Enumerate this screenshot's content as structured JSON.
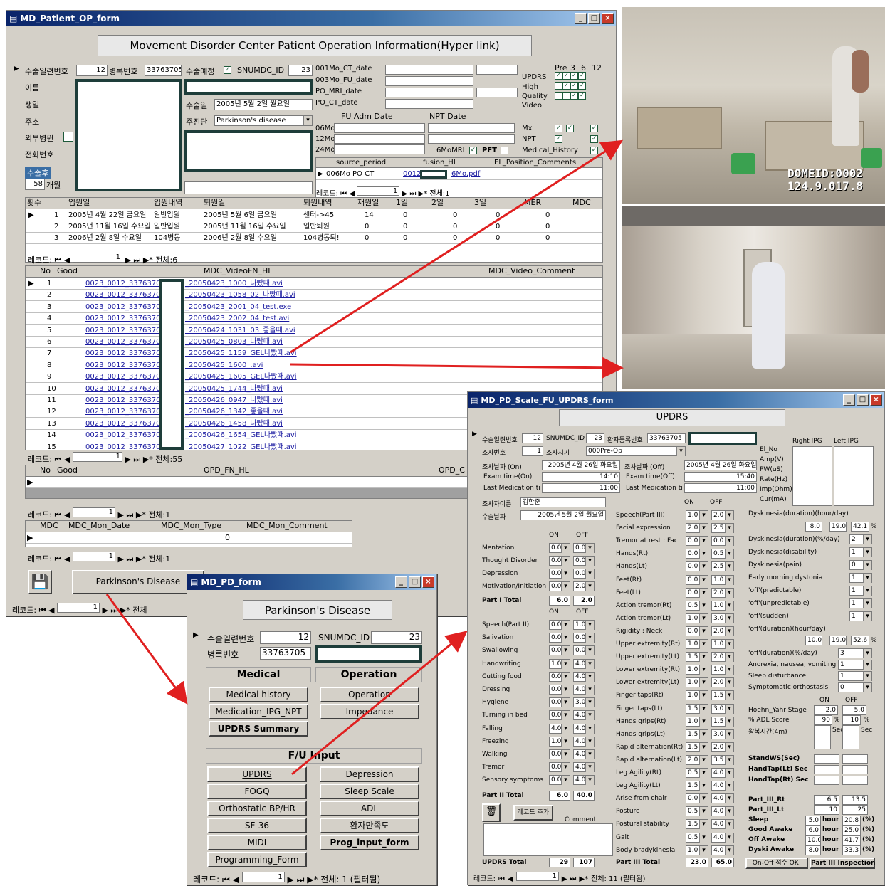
{
  "op_form": {
    "title": "MD_Patient_OP_form",
    "banner": "Movement Disorder Center Patient Operation Information(Hyper link)",
    "labels": {
      "serial": "수술일련번호",
      "name": "이름",
      "birth": "생일",
      "address": "주소",
      "ext_hosp": "외부병원",
      "phone": "전화번호",
      "after_op": "수술후",
      "months": "개월",
      "reg_no": "병록번호",
      "planned": "수술예정",
      "snumdc": "SNUMDC_ID",
      "op_date": "수술일",
      "diag": "주진단"
    },
    "values": {
      "serial": "12",
      "reg_no": "33763705",
      "snumdc": "23",
      "op_date": "2005년 5월 2일 월요일",
      "diag": "Parkinson's disease",
      "months": "58"
    },
    "dates": [
      "001Mo_CT_date",
      "003Mo_FU_date",
      "PO_MRI_date",
      "PO_CT_date"
    ],
    "fu_adm": "FU Adm Date",
    "npt_date": "NPT Date",
    "fu_rows": [
      "06Mo",
      "12Mo",
      "24Mo"
    ],
    "pre_cols": [
      "Pre",
      "3",
      "6",
      "12"
    ],
    "video_labels": [
      "UPDRS",
      "High",
      "Quality",
      "Video"
    ],
    "mx": "Mx",
    "npt": "NPT",
    "mri6": "6MoMRI",
    "pft": "PFT",
    "med_hist": "Medical_History",
    "sub_headers": [
      "source_period",
      "fusion_HL",
      "EL_Position_Comments"
    ],
    "sub_row": {
      "period": "006Mo PO CT",
      "fusion": "0012",
      "file": "6Mo.pdf"
    },
    "sub_nav": {
      "label": "레코드:",
      "pos": "1",
      "total": "전체:1"
    },
    "adm_headers": [
      "횟수",
      "입원일",
      "입원내역",
      "퇴원일",
      "퇴원내역",
      "재원일",
      "1일",
      "2일",
      "3일",
      "MER",
      "MDC"
    ],
    "adm_rows": [
      [
        "1",
        "2005년 4월 22일 금요일",
        "일반입원",
        "2005년 5월 6일 금요일",
        "센터->45",
        "14",
        "0",
        "0",
        "0",
        "0"
      ],
      [
        "2",
        "2005년 11월 16일 수요일",
        "일반입원",
        "2005년 11월 16일 수요일",
        "일반퇴원",
        "0",
        "0",
        "0",
        "0",
        "0"
      ],
      [
        "3",
        "2006년 2월 8일 수요일",
        "104병동!",
        "2006년 2월 8일 수요일",
        "104병동퇴!",
        "0",
        "0",
        "0",
        "0",
        "0"
      ]
    ],
    "adm_nav": {
      "label": "레코드:",
      "pos": "1",
      "total": "전체:6"
    },
    "video_headers": [
      "No",
      "Good",
      "MDC_VideoFN_HL",
      "MDC_Video_Comment"
    ],
    "video_prefix": "0023_0012_33763705",
    "video_rows": [
      [
        "1",
        "_20050423_1000_나빴때.avi"
      ],
      [
        "2",
        "_20050423_1058_02_나빴때.avi"
      ],
      [
        "3",
        "_20050423_2001_04_test.exe"
      ],
      [
        "4",
        "_20050423_2002_04_test.avi"
      ],
      [
        "5",
        "_20050424_1031_03_좋을때.avi"
      ],
      [
        "6",
        "_20050425_0803_나빴때.avi"
      ],
      [
        "7",
        "_20050425_1159_GEL나빴때.avi"
      ],
      [
        "8",
        "_20050425_1600_.avi"
      ],
      [
        "9",
        "_20050425_1605_GEL나빴때.avi"
      ],
      [
        "10",
        "_20050425_1744_나빴때.avi"
      ],
      [
        "11",
        "_20050426_0947_나빴때.avi"
      ],
      [
        "12",
        "_20050426_1342_좋을때.avi"
      ],
      [
        "13",
        "_20050426_1458_나빴때.avi"
      ],
      [
        "14",
        "_20050426_1654_GEL나빴때.avi"
      ],
      [
        "15",
        "_20050427_1022_GEL나빴때.avi"
      ]
    ],
    "video_nav": {
      "label": "레코드:",
      "pos": "1",
      "total": "전체:55"
    },
    "opd_headers": [
      "No",
      "Good",
      "OPD_FN_HL",
      "OPD_C"
    ],
    "opd_nav": {
      "label": "레코드:",
      "pos": "1",
      "total": "전체:1"
    },
    "mon_headers": [
      "MDC",
      "MDC_Mon_Date",
      "MDC_Mon_Type",
      "MDC_Mon_Comment"
    ],
    "mon_row_val": "0",
    "mon_nav": {
      "label": "레코드:",
      "pos": "1",
      "total": "전체:1"
    },
    "pd_button": "Parkinson's Disease",
    "main_nav": {
      "label": "레코드:",
      "pos": "1",
      "total": "전체"
    }
  },
  "photos": {
    "osd1": "DOMEID:0002",
    "osd2": "124.9.017.8"
  },
  "pd_form": {
    "title": "MD_PD_form",
    "banner": "Parkinson's Disease",
    "serial_label": "수술일련번호",
    "serial": "12",
    "snumdc_label": "SNUMDC_ID",
    "snumdc": "23",
    "reg_label": "병록번호",
    "reg": "33763705",
    "medical": "Medical",
    "operation": "Operation",
    "med_buttons": [
      "Medical history",
      "Medication_IPG_NPT",
      "UPDRS  Summary"
    ],
    "op_buttons": [
      "Operation",
      "Impedance"
    ],
    "fu_input": "F/U Input",
    "fu_left": [
      "UPDRS",
      "FOGQ",
      "Orthostatic BP/HR",
      "SF-36",
      "MIDI",
      "Programming_Form"
    ],
    "fu_right": [
      "Depression",
      "Sleep Scale",
      "ADL",
      "환자만족도",
      "Prog_input_form"
    ],
    "nav": {
      "label": "레코드:",
      "pos": "1",
      "total": "전체: 1 (필터됨)"
    }
  },
  "updrs": {
    "title": "MD_PD_Scale_FU_UPDRS_form",
    "banner": "UPDRS",
    "top": {
      "serial_label": "수술일련번호",
      "serial": "12",
      "snumdc_label": "SNUMDC_ID",
      "snumdc": "23",
      "reg_label": "환자등록번호",
      "reg": "33763705",
      "seq_label": "조사번호",
      "seq": "1",
      "period_label": "조사시기",
      "period": "000Pre-Op",
      "on_label": "조사날짜 (On)",
      "on_date": "2005년 4월 26일 화요일",
      "off_label": "조사날짜 (Off)",
      "off_date": "2005년 4월 26일 화요일",
      "exam_on_label": "Exam time(On)",
      "exam_on": "14:10",
      "exam_off_label": "Exam time(Off)",
      "exam_off": "15:40",
      "lastmed_on_label": "Last Medication ti",
      "lastmed_on": "11:00",
      "lastmed_off_label": "Last Medication ti",
      "lastmed_off": "11:00",
      "examiner_label": "조사자이름",
      "examiner": "김한준",
      "opdate_label": "수술날짜",
      "opdate": "2005년 5월 2일 월요일"
    },
    "ipg_labels": [
      "El_No",
      "Amp(V)",
      "PW(uS)",
      "Rate(Hz)",
      "Imp(Ohm)",
      "Cur(mA)"
    ],
    "right_ipg": "Right IPG",
    "left_ipg": "Left IPG",
    "on": "ON",
    "off": "OFF",
    "part1": [
      [
        "Mentation",
        "0.0",
        "0.0"
      ],
      [
        "Thought Disorder",
        "0.0",
        "0.0"
      ],
      [
        "Depression",
        "0.0",
        "0.0"
      ],
      [
        "Motivation/Initiation",
        "0.0",
        "2.0"
      ]
    ],
    "part1_total": [
      "Part I  Total",
      "6.0",
      "2.0"
    ],
    "part2": [
      [
        "Speech(Part II)",
        "0.0",
        "1.0"
      ],
      [
        "Salivation",
        "0.0",
        "0.0"
      ],
      [
        "Swallowing",
        "0.0",
        "0.0"
      ],
      [
        "Handwriting",
        "1.0",
        "4.0"
      ],
      [
        "Cutting food",
        "0.0",
        "4.0"
      ],
      [
        "Dressing",
        "0.0",
        "4.0"
      ],
      [
        "Hygiene",
        "0.0",
        "3.0"
      ],
      [
        "Turning in bed",
        "0.0",
        "4.0"
      ],
      [
        "Falling",
        "4.0",
        "4.0"
      ],
      [
        "Freezing",
        "1.0",
        "4.0"
      ],
      [
        "Walking",
        "0.0",
        "4.0"
      ],
      [
        "Tremor",
        "0.0",
        "4.0"
      ],
      [
        "Sensory symptoms",
        "0.0",
        "4.0"
      ]
    ],
    "part2_total": [
      "Part II  Total",
      "6.0",
      "40.0"
    ],
    "comment": "Comment",
    "add_record": "레코드 추가",
    "updrs_total": [
      "UPDRS Total",
      "29",
      "107"
    ],
    "part3": [
      [
        "Speech(Part III)",
        "1.0",
        "2.0"
      ],
      [
        "Facial expression",
        "2.0",
        "2.5"
      ],
      [
        "Tremor at rest : Fac",
        "0.0",
        "0.0"
      ],
      [
        "Hands(Rt)",
        "0.0",
        "0.5"
      ],
      [
        "Hands(Lt)",
        "0.0",
        "2.5"
      ],
      [
        "Feet(Rt)",
        "0.0",
        "1.0"
      ],
      [
        "Feet(Lt)",
        "0.0",
        "2.0"
      ],
      [
        "Action tremor(Rt)",
        "0.5",
        "1.0"
      ],
      [
        "Action tremor(Lt)",
        "1.0",
        "3.0"
      ],
      [
        "Rigidity : Neck",
        "0.0",
        "2.0"
      ],
      [
        "Upper extremity(Rt)",
        "1.0",
        "1.0"
      ],
      [
        "Upper extremity(Lt)",
        "1.5",
        "2.0"
      ],
      [
        "Lower extremity(Rt)",
        "1.0",
        "1.0"
      ],
      [
        "Lower extremity(Lt)",
        "1.0",
        "2.0"
      ],
      [
        "Finger taps(Rt)",
        "1.0",
        "1.5"
      ],
      [
        "Finger taps(Lt)",
        "1.5",
        "3.0"
      ],
      [
        "Hands grips(Rt)",
        "1.0",
        "1.5"
      ],
      [
        "Hands grips(Lt)",
        "1.5",
        "3.0"
      ],
      [
        "Rapid alternation(Rt)",
        "1.5",
        "2.0"
      ],
      [
        "Rapid alternation(Lt)",
        "2.0",
        "3.5"
      ],
      [
        "Leg Agility(Rt)",
        "0.5",
        "4.0"
      ],
      [
        "Leg Agility(Lt)",
        "1.5",
        "4.0"
      ],
      [
        "Arise from chair",
        "0.0",
        "4.0"
      ],
      [
        "Posture",
        "0.5",
        "4.0"
      ],
      [
        "Postural stability",
        "1.5",
        "4.0"
      ],
      [
        "Gait",
        "0.5",
        "4.0"
      ],
      [
        "Body bradykinesia",
        "1.0",
        "4.0"
      ]
    ],
    "part3_total": [
      "Part III  Total",
      "23.0",
      "65.0"
    ],
    "dysk_head": "Dyskinesia(duration)(hour/day)",
    "dysk_vals": [
      "8.0",
      "19.0",
      "42.1",
      "%"
    ],
    "right_items": [
      [
        "Dyskinesia(duration)(%/day)",
        "2"
      ],
      [
        "Dyskinesia(disability)",
        "1"
      ],
      [
        "Dyskinesia(pain)",
        "0"
      ],
      [
        "Early morning dystonia",
        "1"
      ],
      [
        "'off'(predictable)",
        "1"
      ],
      [
        "'off'(unpredictable)",
        "1"
      ],
      [
        "'off'(sudden)",
        "1"
      ]
    ],
    "off_dur": "'off'(duration)(hour/day)",
    "off_vals": [
      "10.0",
      "19.0",
      "52.6",
      "%"
    ],
    "right_items2": [
      [
        "'off'(duration)(%/day)",
        "3"
      ],
      [
        "Anorexia, nausea, vomiting",
        "1"
      ],
      [
        "Sleep disturbance",
        "1"
      ],
      [
        "Symptomatic orthostasis",
        "0"
      ]
    ],
    "hy_label": "Hoehn_Yahr Stage",
    "hy_on": "2.0",
    "hy_off": "5.0",
    "adl_label": "% ADL Score",
    "adl_on": "90",
    "adl_off": "10",
    "pct": "%",
    "walk_label": "왕복시간(4m)",
    "sec": "Sec",
    "tests": [
      "StandWS(Sec)",
      "HandTap(Lt) Sec",
      "HandTap(Rt) Sec"
    ],
    "parts_rt": [
      "Part_III_Rt",
      "6.5",
      "13.5"
    ],
    "parts_lt": [
      "Part_III_Lt",
      "10",
      "25"
    ],
    "states": [
      [
        "Sleep",
        "5.0",
        "hour",
        "20.8",
        "(%)"
      ],
      [
        "Good Awake",
        "6.0",
        "hour",
        "25.0",
        "(%)"
      ],
      [
        "Off Awake",
        "10.0",
        "hour",
        "41.7",
        "(%)"
      ],
      [
        "Dyski Awake",
        "8.0",
        "hour",
        "33.3",
        "(%)"
      ]
    ],
    "onoff_btn": "On-Off 점수 OK!",
    "part3_btn": "Part III Inspection",
    "nav": {
      "label": "레코드:",
      "pos": "1",
      "total": "전체: 11 (필터됨)"
    }
  }
}
